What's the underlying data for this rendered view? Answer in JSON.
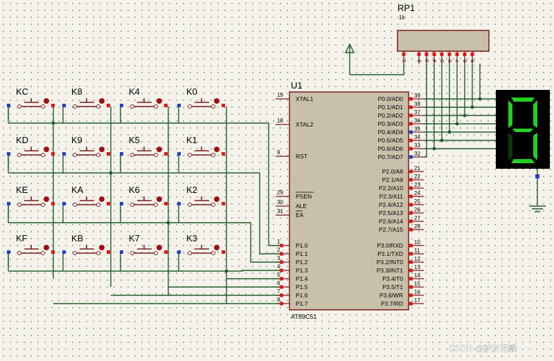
{
  "chip": {
    "ref": "U1",
    "part": "AT89C51",
    "left_pins": [
      {
        "num": "19",
        "name": "XTAL1"
      },
      {
        "num": "18",
        "name": "XTAL2"
      },
      {
        "num": "9",
        "name": "RST"
      },
      {
        "num": "29",
        "name": "PSEN"
      },
      {
        "num": "30",
        "name": "ALE"
      },
      {
        "num": "31",
        "name": "EA"
      },
      {
        "num": "1",
        "name": "P1.0"
      },
      {
        "num": "2",
        "name": "P1.1"
      },
      {
        "num": "3",
        "name": "P1.2"
      },
      {
        "num": "4",
        "name": "P1.3"
      },
      {
        "num": "5",
        "name": "P1.4"
      },
      {
        "num": "6",
        "name": "P1.5"
      },
      {
        "num": "7",
        "name": "P1.6"
      },
      {
        "num": "8",
        "name": "P1.7"
      }
    ],
    "right_pins": [
      {
        "num": "39",
        "name": "P0.0/AD0"
      },
      {
        "num": "38",
        "name": "P0.1/AD1"
      },
      {
        "num": "37",
        "name": "P0.2/AD2"
      },
      {
        "num": "36",
        "name": "P0.3/AD3"
      },
      {
        "num": "35",
        "name": "P0.4/AD4"
      },
      {
        "num": "34",
        "name": "P0.5/AD5"
      },
      {
        "num": "33",
        "name": "P0.6/AD6"
      },
      {
        "num": "32",
        "name": "P0.7/AD7"
      },
      {
        "num": "21",
        "name": "P2.0/A8"
      },
      {
        "num": "22",
        "name": "P2.1/A9"
      },
      {
        "num": "23",
        "name": "P2.2/A10"
      },
      {
        "num": "24",
        "name": "P2.3/A11"
      },
      {
        "num": "25",
        "name": "P2.4/A12"
      },
      {
        "num": "26",
        "name": "P2.5/A13"
      },
      {
        "num": "27",
        "name": "P2.6/A14"
      },
      {
        "num": "28",
        "name": "P2.7/A15"
      },
      {
        "num": "10",
        "name": "P3.0/RXD"
      },
      {
        "num": "11",
        "name": "P3.1/TXD"
      },
      {
        "num": "12",
        "name": "P3.2/INT0"
      },
      {
        "num": "13",
        "name": "P3.3/INT1"
      },
      {
        "num": "14",
        "name": "P3.4/T0"
      },
      {
        "num": "15",
        "name": "P3.5/T1"
      },
      {
        "num": "16",
        "name": "P3.6/WR"
      },
      {
        "num": "17",
        "name": "P3.7/RD"
      }
    ]
  },
  "resistor_pack": {
    "ref": "RP1",
    "value": "1k",
    "pins": [
      "1",
      "2",
      "3",
      "4",
      "5",
      "6",
      "7",
      "8",
      "9"
    ]
  },
  "display": {
    "digit": "9",
    "segment_color": "#22d022",
    "off_color": "#0a3a0a"
  },
  "keys": [
    [
      "KC",
      "K8",
      "K4",
      "K0"
    ],
    [
      "KD",
      "K9",
      "K5",
      "K1"
    ],
    [
      "KE",
      "KA",
      "K6",
      "K2"
    ],
    [
      "KF",
      "KB",
      "K7",
      "K3"
    ]
  ],
  "watermark": "CSDN @驴友花雕",
  "colors": {
    "wire": "#1f5c2a",
    "component": "#7a1a1a",
    "chip_fill": "#c8c0a8",
    "pin_red": "#e01818",
    "pin_blue": "#2040d0"
  }
}
